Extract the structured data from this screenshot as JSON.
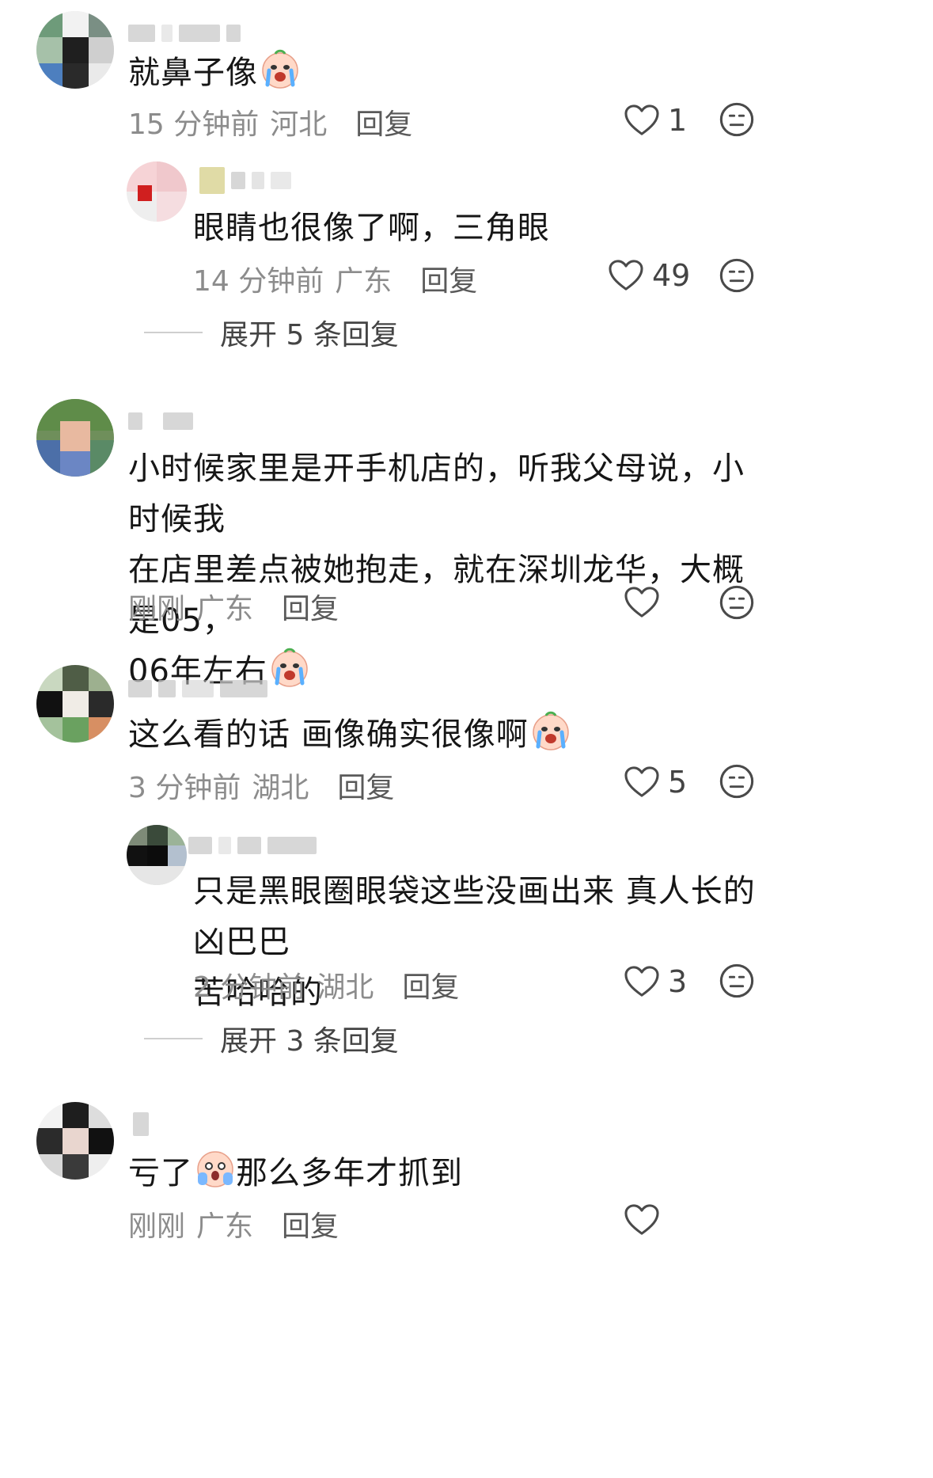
{
  "comments": [
    {
      "text": "就鼻子像",
      "time": "15 分钟前",
      "location": "河北",
      "reply": "回复",
      "likes": "1",
      "emoji": "crying-emoji",
      "reply_item": {
        "text": "眼睛也很像了啊，三角眼",
        "time": "14 分钟前",
        "location": "广东",
        "reply": "回复",
        "likes": "49"
      },
      "expand": "展开 5 条回复"
    },
    {
      "text_lines": [
        "小时候家里是开手机店的，听我父母说，小时候我",
        "在店里差点被她抱走，就在深圳龙华，大概是05，",
        "06年左右"
      ],
      "time": "刚刚",
      "location": "广东",
      "reply": "回复",
      "likes": "",
      "emoji": "crying-emoji"
    },
    {
      "text": "这么看的话 画像确实很像啊",
      "time": "3 分钟前",
      "location": "湖北",
      "reply": "回复",
      "likes": "5",
      "emoji": "crying-emoji",
      "reply_item": {
        "text_lines": [
          "只是黑眼圈眼袋这些没画出来 真人长的凶巴巴",
          "苦哈哈的"
        ],
        "time": "2 分钟前",
        "location": "湖北",
        "reply": "回复",
        "likes": "3"
      },
      "expand": "展开 3 条回复"
    },
    {
      "text_before": "亏了",
      "text_after": "那么多年才抓到",
      "time": "刚刚",
      "location": "广东",
      "reply": "回复",
      "likes": "",
      "emoji": "scared-emoji"
    }
  ],
  "colors": {
    "text": "#161616",
    "meta": "#8c8c8c",
    "reply": "#5a5a5a",
    "icon": "#555555"
  }
}
